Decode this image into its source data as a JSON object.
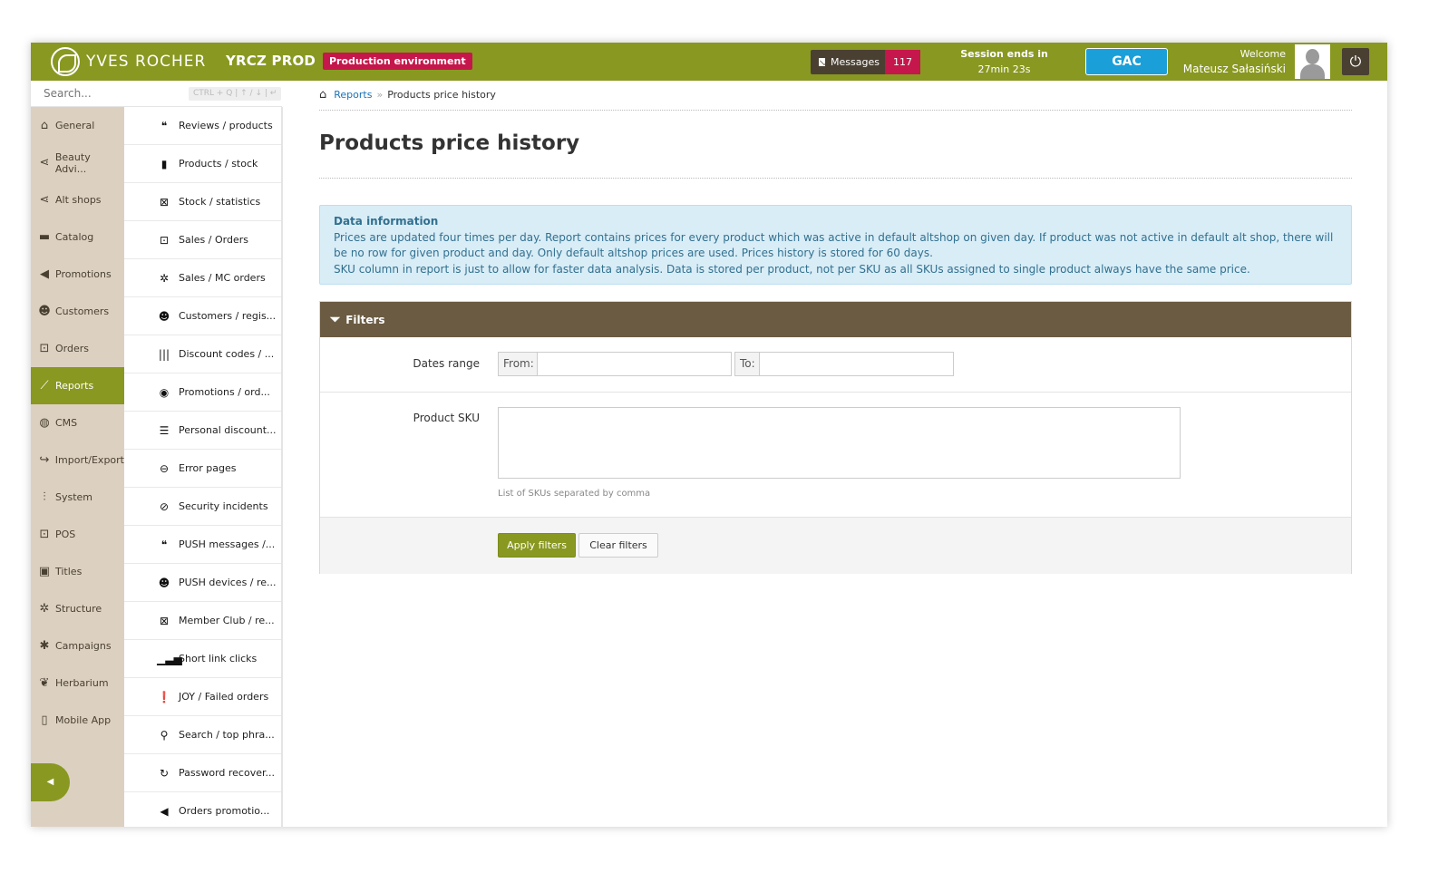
{
  "header": {
    "brand": "YVES ROCHER",
    "env_name": "YRCZ PROD",
    "env_badge": "Production environment",
    "messages_label": "Messages",
    "messages_count": "117",
    "session_label": "Session ends in",
    "session_time": "27min 23s",
    "gac_label": "GAC",
    "welcome_label": "Welcome",
    "user_name": "Mateusz Sałasiński"
  },
  "search": {
    "placeholder": "Search...",
    "shortcut": "CTRL + Q | ↑ / ↓ | ↵"
  },
  "sidebar": {
    "items": [
      {
        "label": "General",
        "icon": "home-icon"
      },
      {
        "label": "Beauty Advi...",
        "icon": "share-icon"
      },
      {
        "label": "Alt shops",
        "icon": "share-icon"
      },
      {
        "label": "Catalog",
        "icon": "folder-icon"
      },
      {
        "label": "Promotions",
        "icon": "megaphone-icon"
      },
      {
        "label": "Customers",
        "icon": "users-icon"
      },
      {
        "label": "Orders",
        "icon": "cart-icon"
      },
      {
        "label": "Reports",
        "icon": "chart-icon",
        "active": true
      },
      {
        "label": "CMS",
        "icon": "globe-icon"
      },
      {
        "label": "Import/Export",
        "icon": "share-arrow-icon"
      },
      {
        "label": "System",
        "icon": "sliders-icon"
      },
      {
        "label": "POS",
        "icon": "cart-icon"
      },
      {
        "label": "Titles",
        "icon": "id-card-icon"
      },
      {
        "label": "Structure",
        "icon": "cogs-icon"
      },
      {
        "label": "Campaigns",
        "icon": "asterisk-icon"
      },
      {
        "label": "Herbarium",
        "icon": "leaf-icon"
      },
      {
        "label": "Mobile App",
        "icon": "mobile-icon"
      }
    ]
  },
  "subnav": {
    "items": [
      {
        "label": "Reviews / products",
        "icon": "comments-icon"
      },
      {
        "label": "Products / stock",
        "icon": "clipboard-icon"
      },
      {
        "label": "Stock / statistics",
        "icon": "monitor-chart-icon"
      },
      {
        "label": "Sales / Orders",
        "icon": "cart-icon"
      },
      {
        "label": "Sales / MC orders",
        "icon": "cog-icon"
      },
      {
        "label": "Customers / regis...",
        "icon": "users-icon"
      },
      {
        "label": "Discount codes / ...",
        "icon": "barcode-icon"
      },
      {
        "label": "Promotions / ord...",
        "icon": "eye-icon"
      },
      {
        "label": "Personal discount...",
        "icon": "list-icon"
      },
      {
        "label": "Error pages",
        "icon": "minus-circle-icon"
      },
      {
        "label": "Security incidents",
        "icon": "ban-icon"
      },
      {
        "label": "PUSH messages /...",
        "icon": "comments-icon"
      },
      {
        "label": "PUSH devices / re...",
        "icon": "user-plus-icon"
      },
      {
        "label": "Member Club / re...",
        "icon": "excel-file-icon"
      },
      {
        "label": "Short link clicks",
        "icon": "bar-chart-icon"
      },
      {
        "label": "JOY / Failed orders",
        "icon": "exclamation-circle-icon"
      },
      {
        "label": "Search / top phra...",
        "icon": "search-icon"
      },
      {
        "label": "Password recover...",
        "icon": "refresh-icon"
      },
      {
        "label": "Orders promotio...",
        "icon": "megaphone-icon"
      }
    ]
  },
  "breadcrumb": {
    "parent": "Reports",
    "separator": "»",
    "current": "Products price history"
  },
  "page": {
    "title": "Products price history"
  },
  "info": {
    "title": "Data information",
    "line1": "Prices are updated four times per day. Report contains prices for every product which was active in default altshop on given day. If product was not active in default alt shop, there will be no row for given product and day. Only default altshop prices are used. Prices history is stored for 60 days.",
    "line2": "SKU column in report is just to allow for faster data analysis. Data is stored per product, not per SKU as all SKUs assigned to single product always have the same price."
  },
  "filters": {
    "title": "Filters",
    "dates_label": "Dates range",
    "from_label": "From:",
    "from_value": "",
    "to_label": "To:",
    "to_value": "",
    "sku_label": "Product SKU",
    "sku_value": "",
    "sku_help": "List of SKUs separated by comma",
    "apply_label": "Apply filters",
    "clear_label": "Clear filters"
  },
  "colors": {
    "brand_green": "#899821",
    "brand_brown": "#6b5b42",
    "badge_red": "#c5174b",
    "gac_blue": "#1a9fd9",
    "sidebar_beige": "#dcd1c1",
    "info_bg": "#d9edf7"
  }
}
